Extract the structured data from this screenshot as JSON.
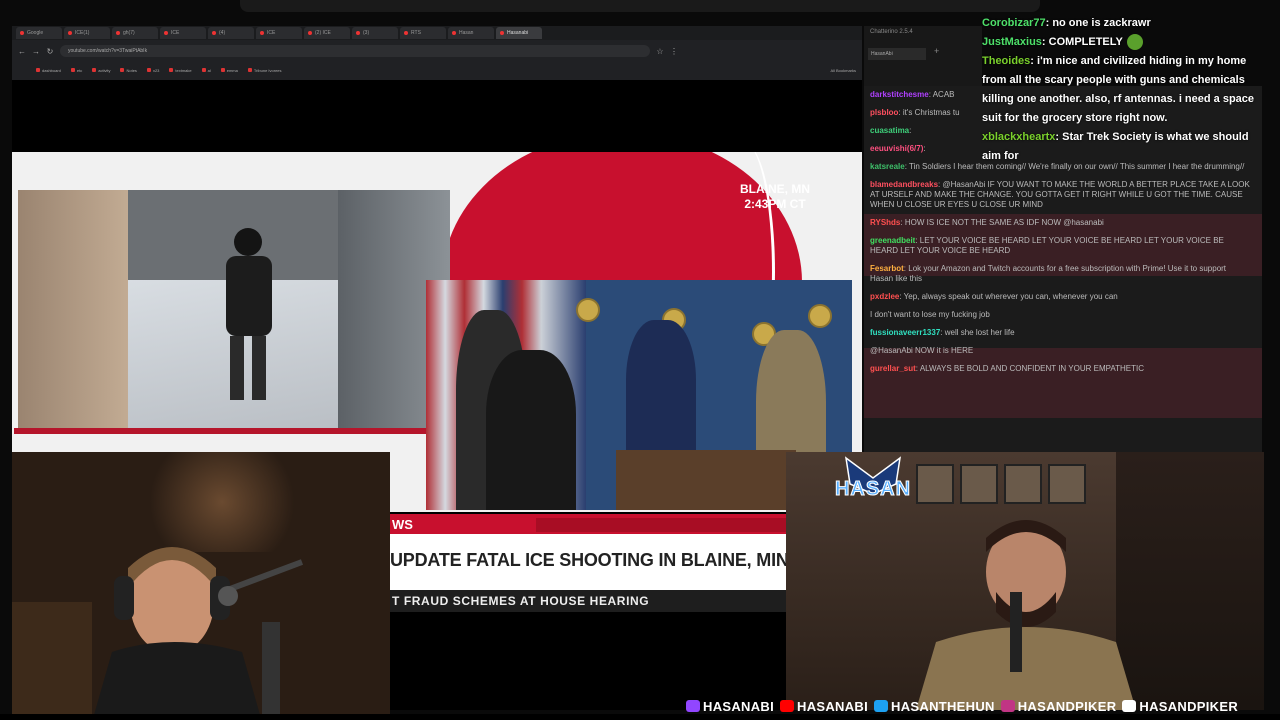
{
  "browser": {
    "tabs": [
      "Google",
      "ICE(1)",
      "gh(7)",
      "ICE",
      "(4)",
      "ICE",
      "(2) ICE",
      "(3)",
      "RTS",
      "Hasan",
      "Hasanabi"
    ],
    "active_tab": "Hasanabi",
    "url": "youtube.com/watch?v=3TwaiPtAbIk",
    "bookmarks": [
      "dashboard",
      "etc",
      "activity",
      "Notes",
      "x23",
      "textmake",
      "al",
      "emma",
      "Tribune Ivorees"
    ],
    "all_bookmarks": "All Bookmarks"
  },
  "news": {
    "location_line1": "BLAINE, MN",
    "location_line2": "2:43PM CT",
    "chyron_tag": "WS",
    "headline": "UPDATE FATAL ICE SHOOTING IN BLAINE, MINNES",
    "subline": "T FRAUD SCHEMES AT HOUSE HEARING"
  },
  "chatterino": {
    "title": "Chatterino 2.5.4",
    "tab": "HasanAbi",
    "lines": [
      {
        "user": "darkstitchesme",
        "text": "ACAB",
        "color": "#b040ff"
      },
      {
        "user": "plsbloo",
        "text": "it's Christmas tu",
        "color": "#ff5060"
      },
      {
        "user": "cuasatima",
        "text": "",
        "color": "#3ed07a"
      },
      {
        "user": "eeuuvishi(6/7)",
        "text": "",
        "color": "#ff5080"
      },
      {
        "user": "katsreale",
        "text": "Tin Soldiers I hear them coming// We're finally on our own// This summer I hear the drumming//",
        "color": "#3ec06a"
      },
      {
        "user": "blamedandbreaks",
        "text": "@HasanAbi IF YOU WANT TO MAKE THE WORLD A BETTER PLACE TAKE A LOOK AT URSELF AND MAKE THE CHANGE. YOU GOTTA GET IT RIGHT WHILE U GOT THE TIME. CAUSE WHEN U CLOSE UR EYES U CLOSE UR MIND",
        "color": "#ff5060"
      },
      {
        "user": "RYShds",
        "text": "HOW IS ICE NOT THE SAME AS IDF NOW @hasanabi",
        "color": "#ff5050"
      },
      {
        "user": "greenadbeit",
        "text": "LET YOUR VOICE BE HEARD  LET YOUR VOICE BE HEARD  LET YOUR VOICE BE HEARD  LET YOUR VOICE BE HEARD",
        "color": "#40e060"
      },
      {
        "user": "Fesarbot",
        "text": "Lok your Amazon and Twitch accounts for a free subscription with Prime! Use it to support Hasan like this",
        "color": "#ffb040"
      },
      {
        "user": "pxdzlee",
        "text": "Yep, always speak out wherever you can, whenever you can",
        "color": "#ff5050"
      },
      {
        "user": "",
        "text": "I don't want to lose my fucking job",
        "color": "#bbb"
      },
      {
        "user": "fussionaveerr1337",
        "text": "well she lost her life",
        "color": "#30e0c0"
      },
      {
        "user": "",
        "text": "@HasanAbi NOW it is HERE",
        "color": "#ff5050"
      },
      {
        "user": "gurellar_sut",
        "text": "ALWAYS BE BOLD AND CONFIDENT IN YOUR EMPATHETIC",
        "color": "#ff5050"
      }
    ]
  },
  "overlay_chat": [
    {
      "user": "Corobizar77",
      "text": "no one is zackrawr",
      "color": "#4ee06a"
    },
    {
      "user": "JustMaxius",
      "text": "COMPLETELY",
      "color": "#4ee06a"
    },
    {
      "user": "Theoides",
      "text": "i'm nice and civilized hiding in my home from all the scary people with guns and chemicals killing one another. also, rf antennas. i need a space suit for the grocery store right now.",
      "color": "#7ad02c"
    },
    {
      "user": "xblackxheartx",
      "text": "Star Trek Society is what we should aim for",
      "color": "#7ad02c"
    }
  ],
  "overlay": {
    "logo": "HASAN",
    "socials": [
      {
        "icon": "twitch-icon",
        "handle": "HASANABI",
        "color": "#9146ff"
      },
      {
        "icon": "youtube-icon",
        "handle": "HASANABI",
        "color": "#ff0000"
      },
      {
        "icon": "twitter-icon",
        "handle": "HASANTHEHUN",
        "color": "#1da1f2"
      },
      {
        "icon": "instagram-icon",
        "handle": "HASANDPIKER",
        "color": "#c13584"
      },
      {
        "icon": "tiktok-icon",
        "handle": "HASANDPIKER",
        "color": "#ffffff"
      }
    ]
  }
}
